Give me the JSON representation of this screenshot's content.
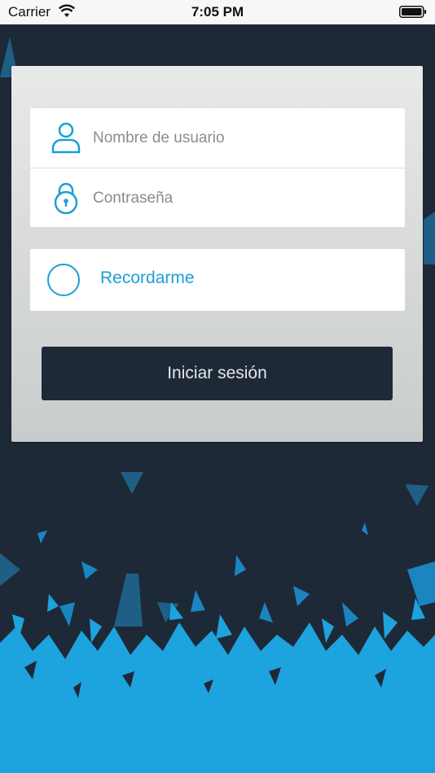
{
  "status_bar": {
    "carrier": "Carrier",
    "time": "7:05 PM",
    "wifi_icon": "wifi-icon",
    "battery_icon": "battery-icon"
  },
  "login": {
    "username_placeholder": "Nombre de usuario",
    "username_icon": "user-icon",
    "password_placeholder": "Contraseña",
    "password_icon": "lock-icon",
    "remember_label": "Recordarme",
    "remember_checked": false,
    "submit_label": "Iniciar sesión"
  },
  "colors": {
    "background": "#1e2937",
    "accent": "#1a9fd8",
    "card": "#dcdedf",
    "button": "#1e2937"
  }
}
